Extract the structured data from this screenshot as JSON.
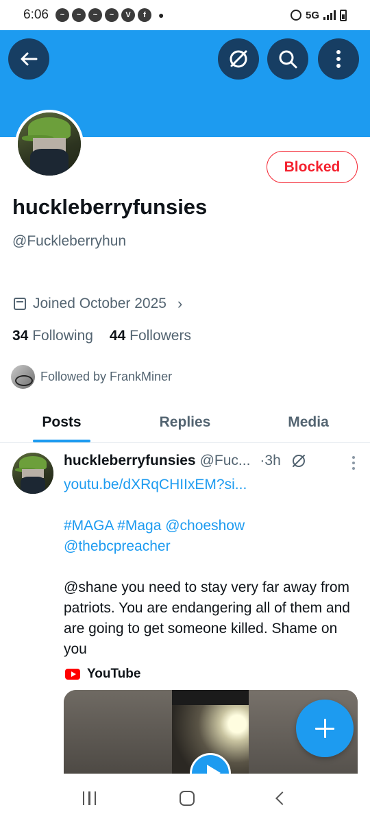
{
  "status_bar": {
    "time": "6:06",
    "network": "5G",
    "notification_icons": [
      "messenger-icon",
      "messenger-icon",
      "messenger-icon",
      "messenger-icon",
      "vector-v-icon",
      "facebook-icon"
    ]
  },
  "header": {
    "banner_color": "#1d9bf0"
  },
  "profile": {
    "display_name": "huckleberryfunsies",
    "handle": "@Fuckleberryhun",
    "blocked_label": "Blocked",
    "joined": "Joined October 2025",
    "following_count": "34",
    "following_label": "Following",
    "followers_count": "44",
    "followers_label": "Followers",
    "followed_by": "Followed by FrankMiner"
  },
  "tabs": [
    {
      "label": "Posts",
      "active": true
    },
    {
      "label": "Replies",
      "active": false
    },
    {
      "label": "Media",
      "active": false
    }
  ],
  "post": {
    "author_name": "huckleberryfunsies",
    "author_handle": "@Fuc...",
    "time": "·3h",
    "link": "youtu.be/dXRqCHIIxEM?si...",
    "hashtags_line1": "#MAGA #Maga @choeshow",
    "hashtags_line2": "@thebcpreacher",
    "body": "@shane you need to stay very far away from patriots. You are endangering all of them and are going to get someone killed. Shame on you",
    "card_source": "YouTube"
  },
  "colors": {
    "accent": "#1d9bf0",
    "blocked": "#f4212e",
    "dark_button": "#173e63"
  }
}
